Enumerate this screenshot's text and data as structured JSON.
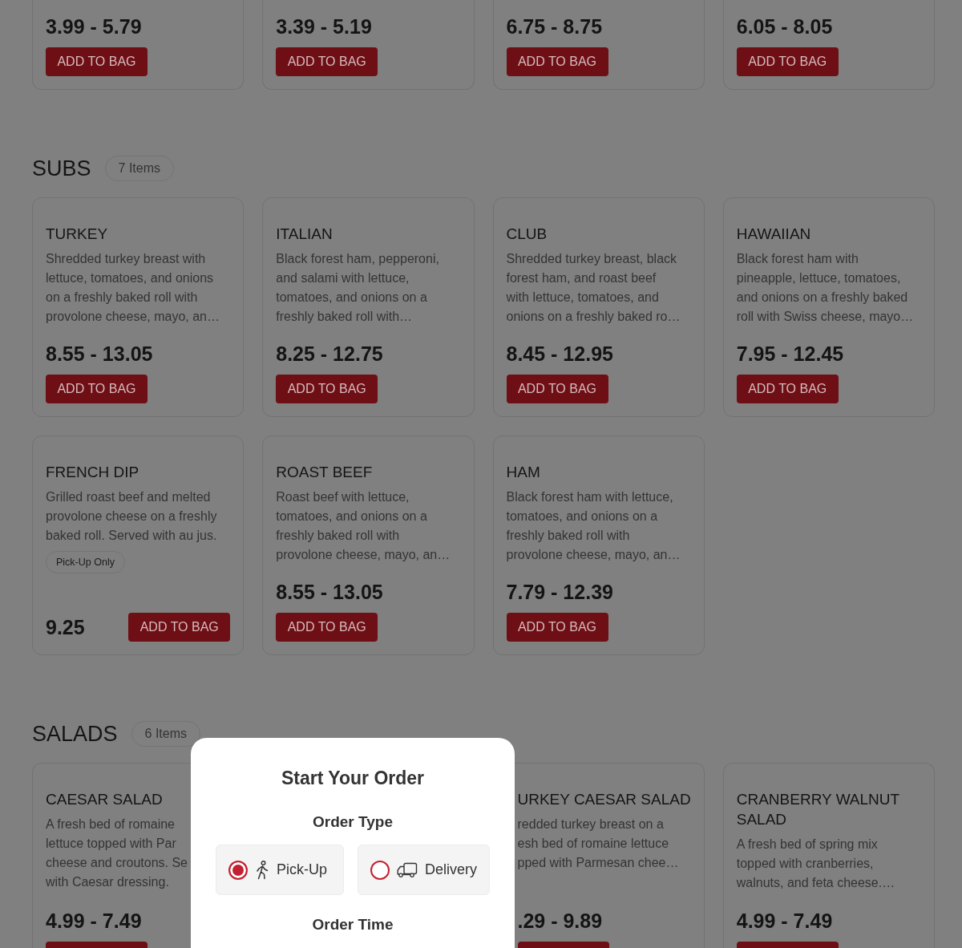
{
  "partial_section": {
    "items": [
      {
        "price": "3.99 - 5.79",
        "button": "ADD TO BAG"
      },
      {
        "price": "3.39 - 5.19",
        "button": "ADD TO BAG"
      },
      {
        "price": "6.75 - 8.75",
        "button": "ADD TO BAG"
      },
      {
        "price": "6.05 - 8.05",
        "button": "ADD TO BAG"
      }
    ]
  },
  "sections": [
    {
      "title": "SUBS",
      "count": "7 Items",
      "items": [
        {
          "kind": "stacked",
          "name": "TURKEY",
          "description": [
            "Shredded turkey breast with",
            "lettuce, tomatoes, and onions",
            "on a freshly baked roll with",
            "provolone cheese, mayo, an…"
          ],
          "price": "8.55 - 13.05",
          "button": "ADD TO BAG"
        },
        {
          "kind": "stacked",
          "name": "ITALIAN",
          "description": [
            "Black forest ham, pepperoni,",
            "and salami with lettuce,",
            "tomatoes, and onions on a",
            "freshly baked roll with…"
          ],
          "price": "8.25 - 12.75",
          "button": "ADD TO BAG"
        },
        {
          "kind": "stacked",
          "name": "CLUB",
          "description": [
            "Shredded turkey breast, black",
            "forest ham, and roast beef",
            "with lettuce, tomatoes, and",
            "onions on a freshly baked ro…"
          ],
          "price": "8.45 - 12.95",
          "button": "ADD TO BAG"
        },
        {
          "kind": "stacked",
          "name": "HAWAIIAN",
          "description": [
            "Black forest ham with",
            "pineapple, lettuce, tomatoes,",
            "and onions on a freshly baked",
            "roll with Swiss cheese, mayo…"
          ],
          "price": "7.95 - 12.45",
          "button": "ADD TO BAG"
        },
        {
          "kind": "inline",
          "name": "FRENCH DIP",
          "description": [
            "Grilled roast beef and melted",
            "provolone cheese on a freshly",
            "baked roll. Served with au jus."
          ],
          "badge": "Pick-Up Only",
          "price": "9.25",
          "button": "ADD TO BAG"
        },
        {
          "kind": "stacked",
          "name": "ROAST BEEF",
          "description": [
            "Roast beef with lettuce,",
            "tomatoes, and onions on a",
            "freshly baked roll with",
            "provolone cheese, mayo, an…"
          ],
          "price": "8.55 - 13.05",
          "button": "ADD TO BAG"
        },
        {
          "kind": "stacked",
          "name": "HAM",
          "description": [
            "Black forest ham with lettuce,",
            "tomatoes, and onions on a",
            "freshly baked roll with",
            "provolone cheese, mayo, an…"
          ],
          "price": "7.79 - 12.39",
          "button": "ADD TO BAG"
        }
      ]
    },
    {
      "title": "SALADS",
      "count": "6 Items",
      "items": [
        {
          "kind": "stacked",
          "name": "CAESAR SALAD",
          "description": [
            "A fresh bed of romaine",
            "lettuce topped with Par",
            "cheese and croutons. Se",
            "with Caesar dressing."
          ],
          "price": "4.99 - 7.49"
        },
        {
          "kind": "stacked",
          "name": "URKEY CAESAR SALAD",
          "description": [
            "redded turkey breast on a",
            "esh bed of romaine lettuce",
            "pped with Parmesan chee…"
          ],
          "price": ".29 - 9.89"
        },
        {
          "kind": "stacked",
          "name": "CRANBERRY WALNUT SALAD",
          "description": [
            "A fresh bed of spring mix",
            "topped with cranberries,",
            "walnuts, and feta cheese.…"
          ],
          "price": "4.99 - 7.49"
        }
      ]
    }
  ],
  "modal": {
    "title": "Start Your Order",
    "order_type_heading": "Order Type",
    "options": [
      {
        "kind": "pickup",
        "label": "Pick-Up",
        "selected": true
      },
      {
        "kind": "delivery",
        "label": "Delivery",
        "selected": false
      }
    ],
    "order_time_heading": "Order Time"
  }
}
